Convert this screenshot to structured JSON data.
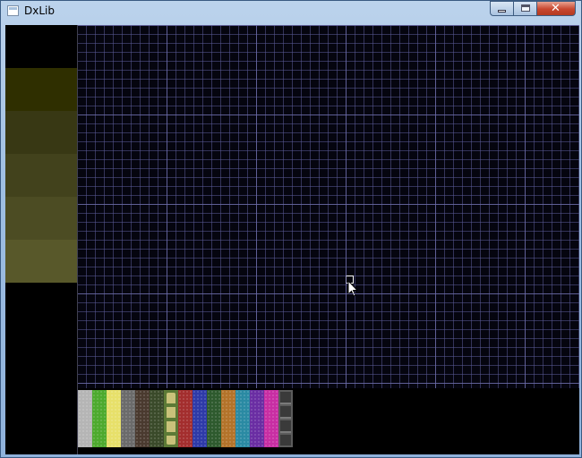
{
  "window": {
    "title": "DxLib",
    "icon": "app-window-icon",
    "controls": {
      "minimize_icon": "minimize-icon",
      "maximize_icon": "maximize-icon",
      "close_glyph": "✕"
    }
  },
  "left_swatches": [
    {
      "color": "#2f2f00"
    },
    {
      "color": "#383814"
    },
    {
      "color": "#42421c"
    },
    {
      "color": "#4c4c23"
    },
    {
      "color": "#58582a"
    }
  ],
  "tile_palette": [
    {
      "name": "gravel",
      "color": "#b5b5b5",
      "pattern": "speck"
    },
    {
      "name": "grass",
      "color": "#4daa2e",
      "pattern": "speck"
    },
    {
      "name": "sand",
      "color": "#e7e06a",
      "pattern": "speck"
    },
    {
      "name": "stone",
      "color": "#6b6b6b",
      "pattern": "speck"
    },
    {
      "name": "dirt",
      "color": "#4a3a2f",
      "pattern": "speck"
    },
    {
      "name": "moss",
      "color": "#3a4a2a",
      "pattern": "speck"
    },
    {
      "name": "sand-blocks",
      "color": "#5c7a36",
      "pattern": "sand-blocks"
    },
    {
      "name": "red",
      "color": "#a32e2e",
      "pattern": "speck"
    },
    {
      "name": "blue",
      "color": "#2e3aa8",
      "pattern": "speck"
    },
    {
      "name": "dark-green",
      "color": "#2e5a2e",
      "pattern": "speck"
    },
    {
      "name": "orange",
      "color": "#b3732a",
      "pattern": "speck"
    },
    {
      "name": "teal",
      "color": "#2a8aa3",
      "pattern": "speck"
    },
    {
      "name": "purple",
      "color": "#6a2ea3",
      "pattern": "speck"
    },
    {
      "name": "magenta",
      "color": "#c82ea3",
      "pattern": "speck"
    },
    {
      "name": "stone-blocks",
      "color": "#5c5c5c",
      "pattern": "stone-blocks"
    }
  ],
  "colors": {
    "client_background": "#000000",
    "grid_background": "#05050f",
    "grid_line": "#5a5a96"
  }
}
